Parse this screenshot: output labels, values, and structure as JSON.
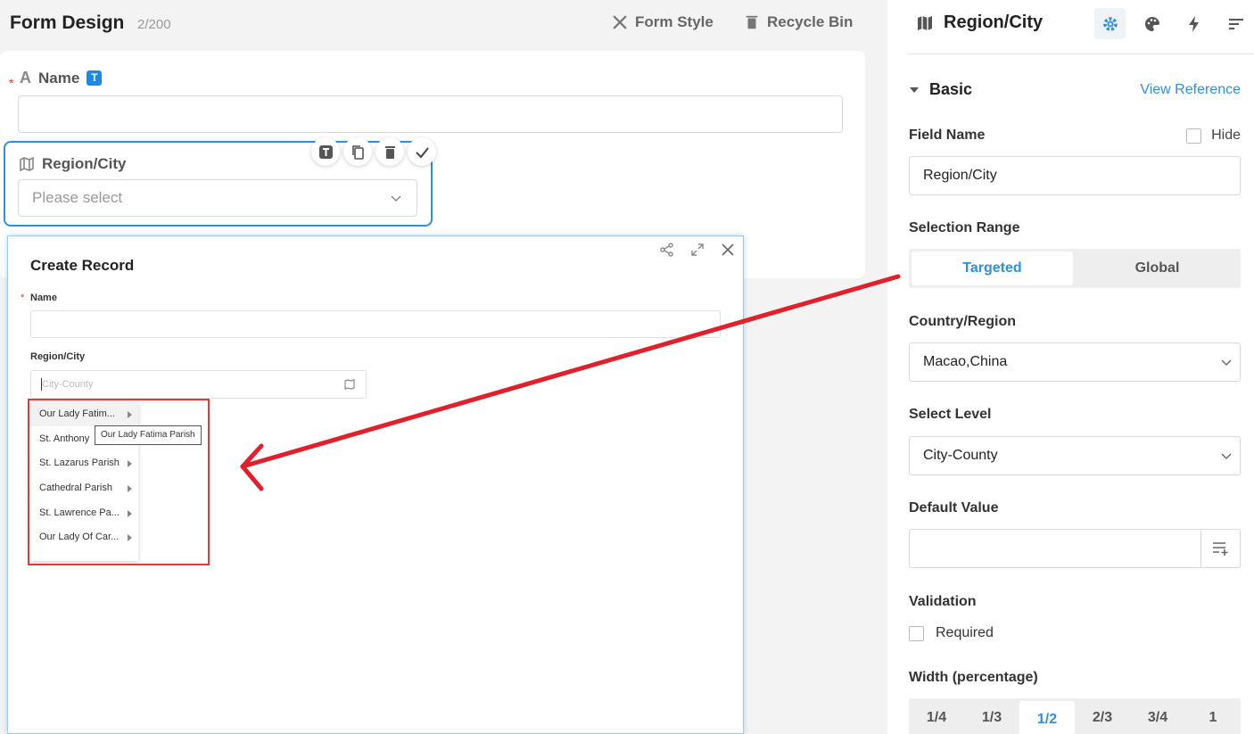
{
  "topbar": {
    "title": "Form Design",
    "count": "2/200",
    "form_style": "Form Style",
    "recycle_bin": "Recycle Bin"
  },
  "canvas": {
    "name_field": {
      "label": "Name",
      "required": "*",
      "type_badge": "T"
    },
    "region_field": {
      "label": "Region/City",
      "placeholder": "Please select"
    }
  },
  "dialog": {
    "title": "Create Record",
    "name_label": "Name",
    "required": "*",
    "region_label": "Region/City",
    "region_placeholder": "City-County",
    "cascader": [
      {
        "label": "Our Lady Fatim..."
      },
      {
        "label": "St. Anthony"
      },
      {
        "label": "St. Lazarus Parish"
      },
      {
        "label": "Cathedral Parish"
      },
      {
        "label": "St. Lawrence Pa..."
      },
      {
        "label": "Our Lady Of Car..."
      }
    ],
    "tooltip": "Our Lady Fatima Parish"
  },
  "panel": {
    "title": "Region/City",
    "section": "Basic",
    "view_reference": "View Reference",
    "field_name_label": "Field Name",
    "hide_label": "Hide",
    "field_name_value": "Region/City",
    "selection_range_label": "Selection Range",
    "range_options": [
      "Targeted",
      "Global"
    ],
    "range_selected": "Targeted",
    "country_label": "Country/Region",
    "country_value": "Macao,China",
    "level_label": "Select Level",
    "level_value": "City-County",
    "default_value_label": "Default Value",
    "default_value": "",
    "validation_label": "Validation",
    "required_label": "Required",
    "width_label": "Width (percentage)",
    "width_options": [
      "1/4",
      "1/3",
      "1/2",
      "2/3",
      "3/4",
      "1"
    ],
    "width_selected": "1/2"
  },
  "colors": {
    "accent": "#2d8ee8",
    "highlight": "#e53935"
  }
}
